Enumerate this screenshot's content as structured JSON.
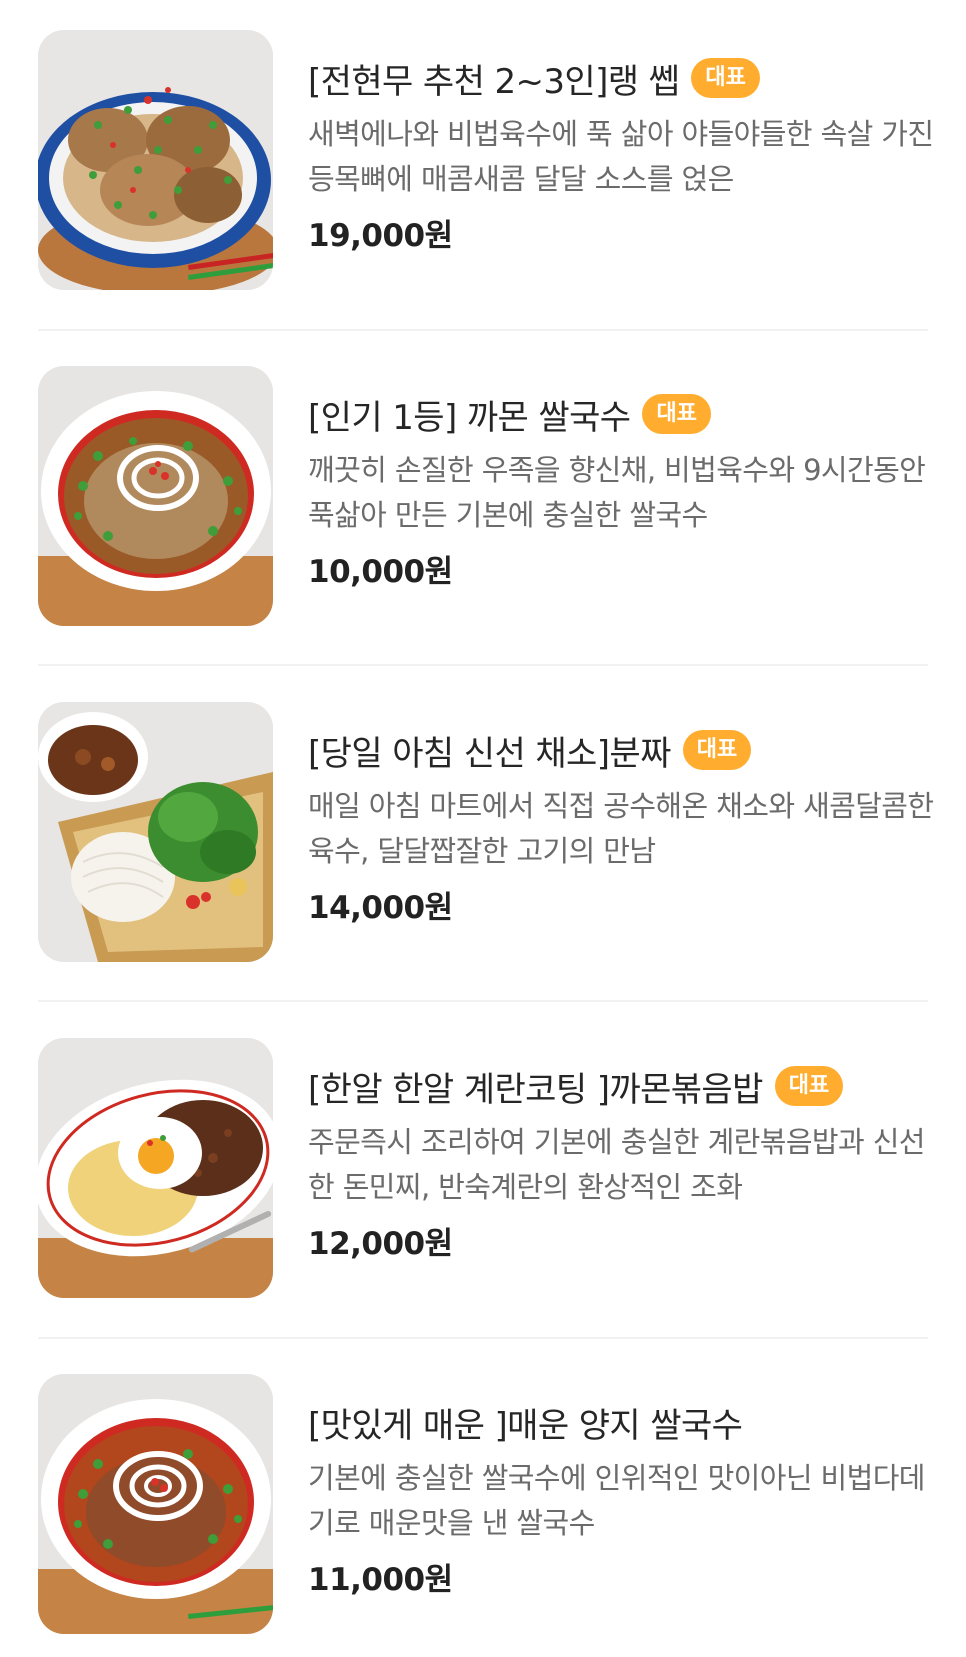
{
  "menu": {
    "items": [
      {
        "title": "[전현무 추천 2~3인]랭 쎕",
        "badge": "대표",
        "description": "새벽에나와 비법육수에 푹 삶아 야들야들한 속살 가진 등목뼈에 매콤새콤 달달 소스를 얹은",
        "price": "19,000원",
        "image_icon": "braised-pork-ribs-photo"
      },
      {
        "title": "[인기 1등] 까몬 쌀국수",
        "badge": "대표",
        "description": "깨끗히 손질한 우족을 향신채, 비법육수와 9시간동안 푹삶아 만든 기본에 충실한 쌀국수",
        "price": "10,000원",
        "image_icon": "rice-noodle-soup-photo"
      },
      {
        "title": "[당일 아침 신선 채소]분짜",
        "badge": "대표",
        "description": "매일 아침 마트에서 직접 공수해온 채소와 새콤달콤한 육수, 달달짭잘한 고기의 만남",
        "price": "14,000원",
        "image_icon": "bun-cha-photo"
      },
      {
        "title": "[한알 한알 계란코팅 ]까몬볶음밥",
        "badge": "대표",
        "description": "주문즉시 조리하여 기본에 충실한 계란볶음밥과 신선한 돈민찌, 반숙계란의 환상적인 조화",
        "price": "12,000원",
        "image_icon": "fried-rice-egg-photo"
      },
      {
        "title": "[맛있게 매운 ]매운 양지 쌀국수",
        "badge": "",
        "description": "기본에 충실한 쌀국수에 인위적인 맛이아닌 비법다데기로 매운맛을 낸 쌀국수",
        "price": "11,000원",
        "image_icon": "spicy-brisket-noodle-photo"
      }
    ]
  },
  "colors": {
    "badge_bg": "#ffac2f",
    "badge_text": "#ffffff",
    "title": "#262626",
    "description": "#6b6b6b",
    "price": "#222222",
    "divider": "#f1f1f1"
  }
}
